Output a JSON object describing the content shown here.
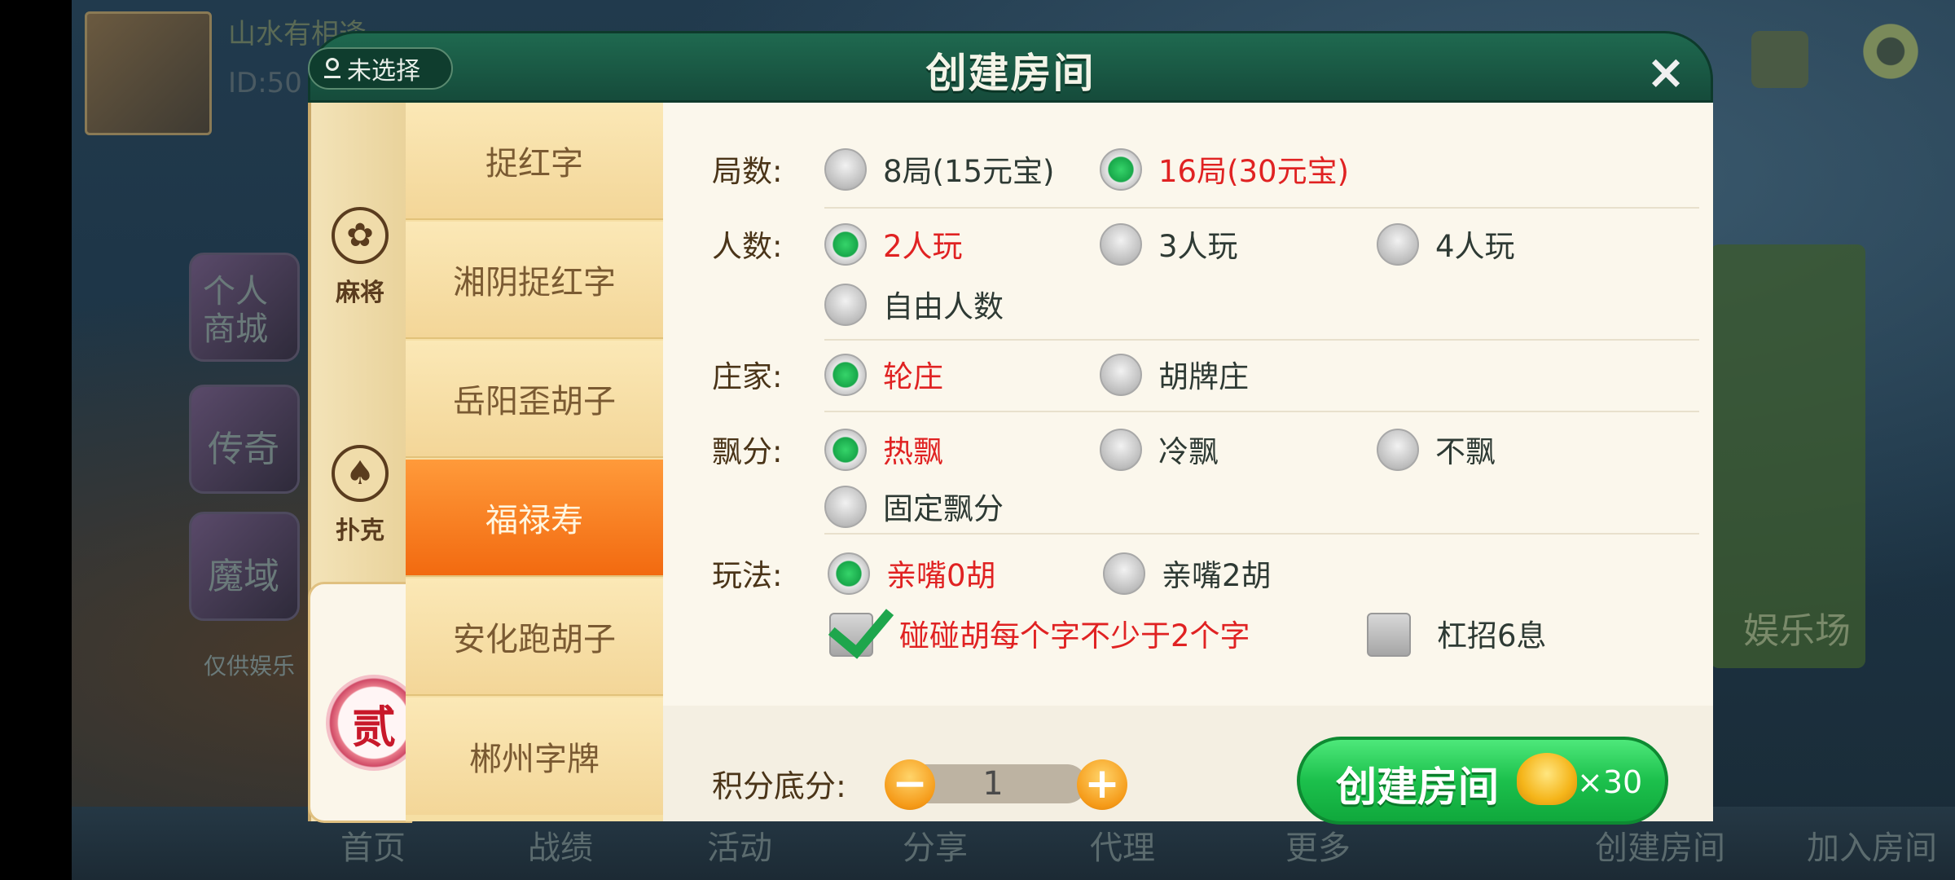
{
  "background": {
    "player_name": "山水有相逢",
    "player_id": "ID:50",
    "tiles": [
      "个人商城",
      "传奇",
      "魔域"
    ],
    "demo_note": "仅供娱乐",
    "right_text": "娱乐场",
    "bottom_nav": [
      "首页",
      "战绩",
      "活动",
      "分享",
      "代理",
      "更多",
      "创建房间",
      "加入房间"
    ]
  },
  "dialog": {
    "title": "创建房间",
    "location": "未选择",
    "close_symbol": "×"
  },
  "categories": [
    {
      "label": "麻将",
      "icon": "mahjong-flower-icon"
    },
    {
      "label": "扑克",
      "icon": "spade-icon"
    },
    {
      "label": "贰",
      "icon": "two-seal-icon",
      "active": true
    }
  ],
  "games": [
    {
      "label": "捉红字"
    },
    {
      "label": "湘阴捉红字"
    },
    {
      "label": "岳阳歪胡子"
    },
    {
      "label": "福禄寿",
      "active": true
    },
    {
      "label": "安化跑胡子"
    },
    {
      "label": "郴州字牌"
    }
  ],
  "options": {
    "rounds": {
      "label": "局数:",
      "choices": [
        "8局(15元宝)",
        "16局(30元宝)"
      ],
      "selected": 1
    },
    "players": {
      "label": "人数:",
      "choices": [
        "2人玩",
        "3人玩",
        "4人玩",
        "自由人数"
      ],
      "selected": 0
    },
    "dealer": {
      "label": "庄家:",
      "choices": [
        "轮庄",
        "胡牌庄"
      ],
      "selected": 0
    },
    "float": {
      "label": "飘分:",
      "choices": [
        "热飘",
        "冷飘",
        "不飘",
        "固定飘分"
      ],
      "selected": 0
    },
    "rules": {
      "label": "玩法:",
      "choices": [
        "亲嘴0胡",
        "亲嘴2胡"
      ],
      "selected": 0,
      "checks": [
        {
          "label": "碰碰胡每个字不少于2个字",
          "checked": true
        },
        {
          "label": "杠招6息",
          "checked": false
        }
      ]
    }
  },
  "score": {
    "label": "积分底分:",
    "value": "1",
    "minus": "−",
    "plus": "+"
  },
  "create_button": {
    "label": "创建房间",
    "cost": "×30"
  },
  "colors": {
    "accent_green": "#1cc04c",
    "selected_text": "#e02222",
    "header_green": "#1f6a50",
    "active_game": "#f26a10"
  }
}
